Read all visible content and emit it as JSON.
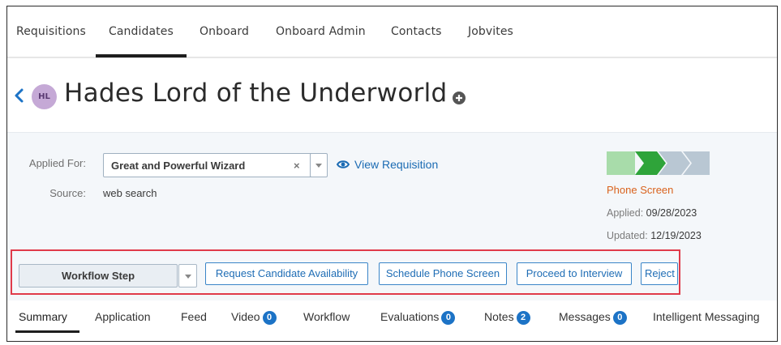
{
  "topnav": {
    "tabs": [
      {
        "label": "Requisitions"
      },
      {
        "label": "Candidates"
      },
      {
        "label": "Onboard"
      },
      {
        "label": "Onboard Admin"
      },
      {
        "label": "Contacts"
      },
      {
        "label": "Jobvites"
      }
    ],
    "active": "Candidates"
  },
  "candidate": {
    "initials": "HL",
    "name": "Hades Lord of the Underworld",
    "avatar_color": "#c5a9d6"
  },
  "details": {
    "applied_for_label": "Applied For:",
    "applied_for_value": "Great and Powerful Wizard",
    "clear_symbol": "×",
    "view_requisition": "View Requisition",
    "source_label": "Source:",
    "source_value": "web search"
  },
  "workflow_status": {
    "stage": "Phone Screen",
    "applied_label": "Applied:",
    "applied_date": "09/28/2023",
    "updated_label": "Updated:",
    "updated_date": "12/19/2023",
    "step_colors": [
      "#a8dcaa",
      "#2fa43a",
      "#b9c7d3",
      "#b9c7d3"
    ],
    "status_color": "#d9621d"
  },
  "actions": {
    "workflow_step": "Workflow Step",
    "buttons": [
      {
        "label": "Request Candidate Availability"
      },
      {
        "label": "Schedule Phone Screen"
      },
      {
        "label": "Proceed to Interview"
      },
      {
        "label": "Reject"
      }
    ],
    "highlight_color": "#e03b4a"
  },
  "bottom_tabs": {
    "summary": "Summary",
    "application": "Application",
    "feed": "Feed",
    "video": "Video",
    "video_count": "0",
    "workflow": "Workflow",
    "evaluations": "Evaluations",
    "evaluations_count": "0",
    "notes": "Notes",
    "notes_count": "2",
    "messages": "Messages",
    "messages_count": "0",
    "intelligent_messaging": "Intelligent Messaging"
  },
  "accent_color": "#1c73c6"
}
